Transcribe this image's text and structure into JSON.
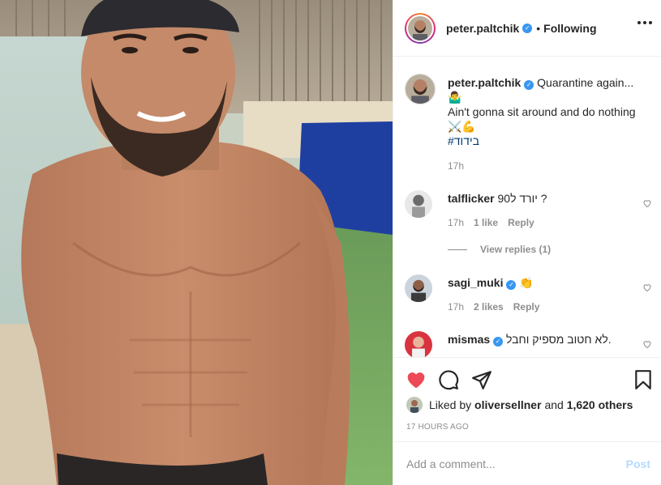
{
  "post": {
    "author": "peter.paltchik",
    "follow_status": "Following",
    "dot": "•"
  },
  "caption": {
    "username": "peter.paltchik",
    "line1": "Quarantine again...",
    "emoji1": "🤷‍♂️",
    "line2": "Ain't gonna sit around and do nothing",
    "emoji2": "⚔️💪",
    "hashtag": "#בידוד",
    "time": "17h"
  },
  "comments": [
    {
      "username": "talflicker",
      "text": "יורד ל90 ?",
      "time": "17h",
      "likes": "1 like",
      "reply": "Reply",
      "view_replies": "View replies (1)"
    },
    {
      "username": "sagi_muki",
      "text": "👏",
      "time": "17h",
      "likes": "2 likes",
      "reply": "Reply"
    },
    {
      "username": "mismas",
      "text": "לא חטוב מספיק וחבל."
    }
  ],
  "likes": {
    "prefix": "Liked by",
    "user": "oliversellner",
    "and": "and",
    "others": "1,620 others"
  },
  "timestamp": "17 HOURS AGO",
  "composer": {
    "placeholder": "Add a comment...",
    "post_label": "Post"
  },
  "colors": {
    "liked_heart": "#ed4956",
    "verified": "#3897f0",
    "post_disabled": "#b3dbff",
    "muted": "#8e8e8e"
  },
  "icons": [
    "more-options-icon",
    "heart-filled-icon",
    "comment-icon",
    "share-icon",
    "bookmark-icon",
    "heart-outline-icon",
    "verified-icon"
  ]
}
